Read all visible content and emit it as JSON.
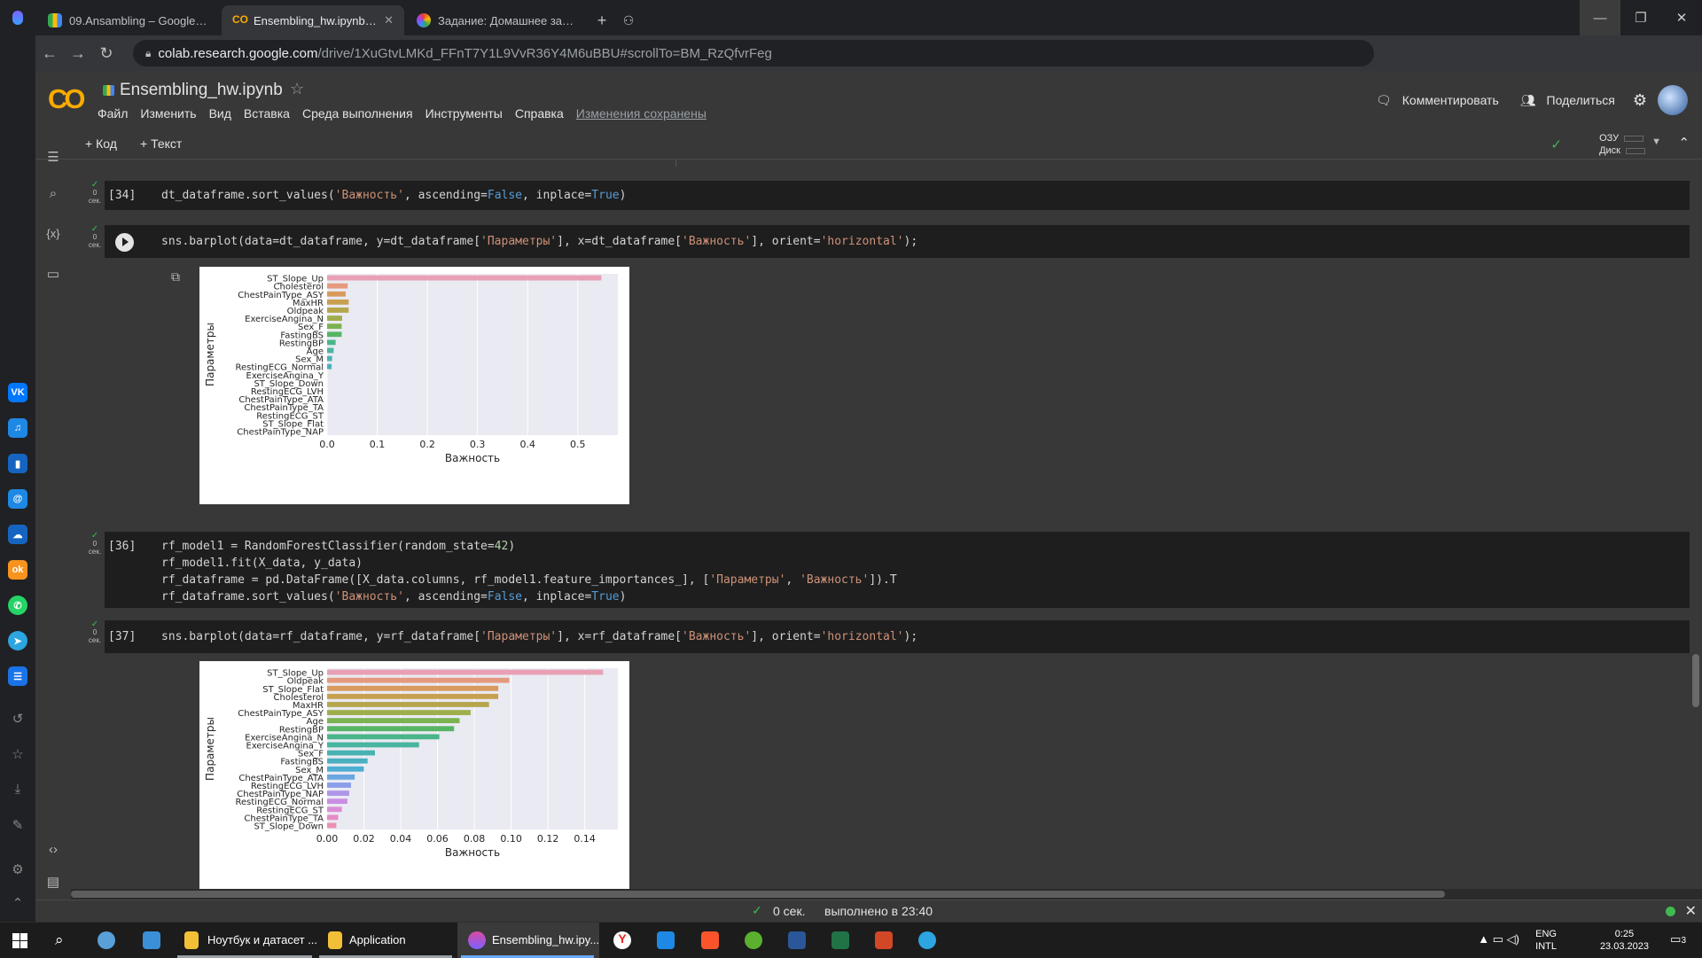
{
  "browser": {
    "tabs": [
      {
        "title": "09.Ansambling – Google Ди",
        "active": false,
        "icon": "google-drive-icon"
      },
      {
        "title": "Ensembling_hw.ipynb - Cola",
        "active": true,
        "icon": "colab-icon"
      },
      {
        "title": "Задание: Домашнее задани",
        "active": false,
        "icon": "skillbox-icon"
      }
    ],
    "url_host": "colab.research.google.com",
    "url_path": "/drive/1XuGtvLMKd_FFnT7Y1L9VvR36Y4M6uBBU#scrollTo=BM_RzQfvrFeg"
  },
  "colab": {
    "notebook_name": "Ensembling_hw.ipynb",
    "menu": [
      "Файл",
      "Изменить",
      "Вид",
      "Вставка",
      "Среда выполнения",
      "Инструменты",
      "Справка"
    ],
    "saved_status": "Изменения сохранены",
    "comment_label": "Комментировать",
    "share_label": "Поделиться",
    "add_code": "+ Код",
    "add_text": "+ Текст",
    "ram_label": "ОЗУ",
    "disk_label": "Диск"
  },
  "cells": [
    {
      "id": "c34",
      "exec": "[34]",
      "gutter": "0 сек.",
      "lines": [
        "dt_dataframe.sort_values('Важность', ascending=False, inplace=True)"
      ]
    },
    {
      "id": "c35",
      "exec": "",
      "gutter": "0 сек.",
      "lines": [
        "sns.barplot(data=dt_dataframe, y=dt_dataframe['Параметры'], x=dt_dataframe['Важность'], orient='horizontal');"
      ]
    },
    {
      "id": "c36",
      "exec": "[36]",
      "gutter": "0 сек.",
      "lines": [
        "rf_model1 = RandomForestClassifier(random_state=42)",
        "rf_model1.fit(X_data, y_data)",
        "rf_dataframe = pd.DataFrame([X_data.columns, rf_model1.feature_importances_], ['Параметры', 'Важность']).T",
        "rf_dataframe.sort_values('Важность', ascending=False, inplace=True)"
      ]
    },
    {
      "id": "c37",
      "exec": "[37]",
      "gutter": "0 сек.",
      "lines": [
        "sns.barplot(data=rf_dataframe, y=rf_dataframe['Параметры'], x=rf_dataframe['Важность'], orient='horizontal');"
      ]
    }
  ],
  "chart_data": [
    {
      "type": "bar",
      "orientation": "horizontal",
      "xlabel": "Важность",
      "ylabel": "Параметры",
      "xlim": [
        0,
        0.58
      ],
      "xticks": [
        "0.0",
        "0.1",
        "0.2",
        "0.3",
        "0.4",
        "0.5"
      ],
      "xtick_values": [
        0,
        0.1,
        0.2,
        0.3,
        0.4,
        0.5
      ],
      "grid": true,
      "categories": [
        "ST_Slope_Up",
        "Cholesterol",
        "ChestPainType_ASY",
        "MaxHR",
        "Oldpeak",
        "ExerciseAngina_N",
        "Sex_F",
        "FastingBS",
        "RestingBP",
        "Age",
        "Sex_M",
        "RestingECG_Normal",
        "ExerciseAngina_Y",
        "ST_Slope_Down",
        "RestingECG_LVH",
        "ChestPainType_ATA",
        "ChestPainType_TA",
        "RestingECG_ST",
        "ST_Slope_Flat",
        "ChestPainType_NAP"
      ],
      "values": [
        0.547,
        0.041,
        0.037,
        0.043,
        0.043,
        0.03,
        0.029,
        0.029,
        0.017,
        0.013,
        0.01,
        0.009,
        0,
        0,
        0,
        0,
        0,
        0,
        0,
        0
      ]
    },
    {
      "type": "bar",
      "orientation": "horizontal",
      "xlabel": "Важность",
      "ylabel": "Параметры",
      "xlim": [
        0,
        0.158
      ],
      "xticks": [
        "0.00",
        "0.02",
        "0.04",
        "0.06",
        "0.08",
        "0.10",
        "0.12",
        "0.14"
      ],
      "xtick_values": [
        0,
        0.02,
        0.04,
        0.06,
        0.08,
        0.1,
        0.12,
        0.14
      ],
      "grid": true,
      "categories": [
        "ST_Slope_Up",
        "Oldpeak",
        "ST_Slope_Flat",
        "Cholesterol",
        "MaxHR",
        "ChestPainType_ASY",
        "Age",
        "RestingBP",
        "ExerciseAngina_N",
        "ExerciseAngina_Y",
        "Sex_F",
        "FastingBS",
        "Sex_M",
        "ChestPainType_ATA",
        "RestingECG_LVH",
        "ChestPainType_NAP",
        "RestingECG_Normal",
        "RestingECG_ST",
        "ChestPainType_TA",
        "ST_Slope_Down"
      ],
      "values": [
        0.15,
        0.099,
        0.093,
        0.093,
        0.088,
        0.078,
        0.072,
        0.069,
        0.061,
        0.05,
        0.026,
        0.022,
        0.02,
        0.015,
        0.013,
        0.012,
        0.011,
        0.008,
        0.006,
        0.005
      ]
    }
  ],
  "palette": [
    "#e8a0b4",
    "#e59a7f",
    "#d99a5e",
    "#c7a050",
    "#b5a64c",
    "#9fae4c",
    "#7ab34f",
    "#56b563",
    "#4ab58a",
    "#48b5a0",
    "#49b2b1",
    "#4ab0c0",
    "#4dadd3",
    "#6aa6e0",
    "#8b9ee8",
    "#ae96e8",
    "#c98ee2",
    "#dc8cd6",
    "#e68cc4",
    "#ec90b2"
  ],
  "status": {
    "time": "0 сек.",
    "completed": "выполнено в 23:40"
  },
  "taskbar": {
    "items": [
      {
        "label": "Ноутбук и датасет ..."
      },
      {
        "label": "Application"
      },
      {
        "label": "Ensembling_hw.ipy..."
      }
    ],
    "lang1": "ENG",
    "lang2": "INTL",
    "time": "0:25",
    "date": "23.03.2023",
    "notif": "3"
  }
}
